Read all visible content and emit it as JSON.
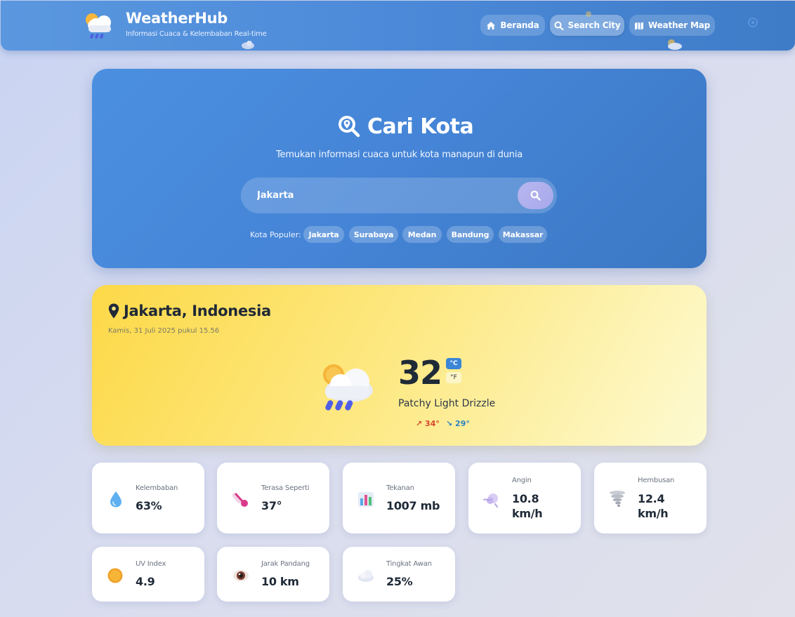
{
  "header": {
    "title": "WeatherHub",
    "subtitle": "Informasi Cuaca & Kelembaban Real-time",
    "nav": [
      {
        "label": "Beranda",
        "icon": "home-icon"
      },
      {
        "label": "Search City",
        "icon": "search-icon",
        "active": true
      },
      {
        "label": "Weather Map",
        "icon": "map-icon"
      }
    ]
  },
  "search": {
    "title": "Cari Kota",
    "description": "Temukan informasi cuaca untuk kota manapun di dunia",
    "value": "Jakarta",
    "popular_label": "Kota Populer:",
    "popular": [
      "Jakarta",
      "Surabaya",
      "Medan",
      "Bandung",
      "Makassar"
    ]
  },
  "weather": {
    "location": "Jakarta, Indonesia",
    "datetime": "Kamis, 31 Juli 2025 pukul 15.56",
    "temperature": "32",
    "unit_c": "°C",
    "unit_f": "°F",
    "condition": "Patchy Light Drizzle",
    "high": "↗ 34°",
    "low": "↘ 29°"
  },
  "stats": [
    {
      "label": "Kelembaban",
      "value": "63%",
      "icon": "droplet-icon"
    },
    {
      "label": "Terasa Seperti",
      "value": "37°",
      "icon": "thermometer-icon"
    },
    {
      "label": "Tekanan",
      "value": "1007 mb",
      "icon": "bar-chart-icon"
    },
    {
      "label": "Angin",
      "value": "10.8 km/h",
      "icon": "wind-icon"
    },
    {
      "label": "Hembusan",
      "value": "12.4 km/h",
      "icon": "tornado-icon"
    },
    {
      "label": "UV Index",
      "value": "4.9",
      "icon": "sun-icon"
    },
    {
      "label": "Jarak Pandang",
      "value": "10 km",
      "icon": "eye-icon"
    },
    {
      "label": "Tingkat Awan",
      "value": "25%",
      "icon": "cloud-icon"
    }
  ],
  "colors": {
    "header": "#4c8ad9",
    "search_card": "#4584d6",
    "weather_card": "#fde985",
    "celsius_active": "#3b86d6"
  }
}
